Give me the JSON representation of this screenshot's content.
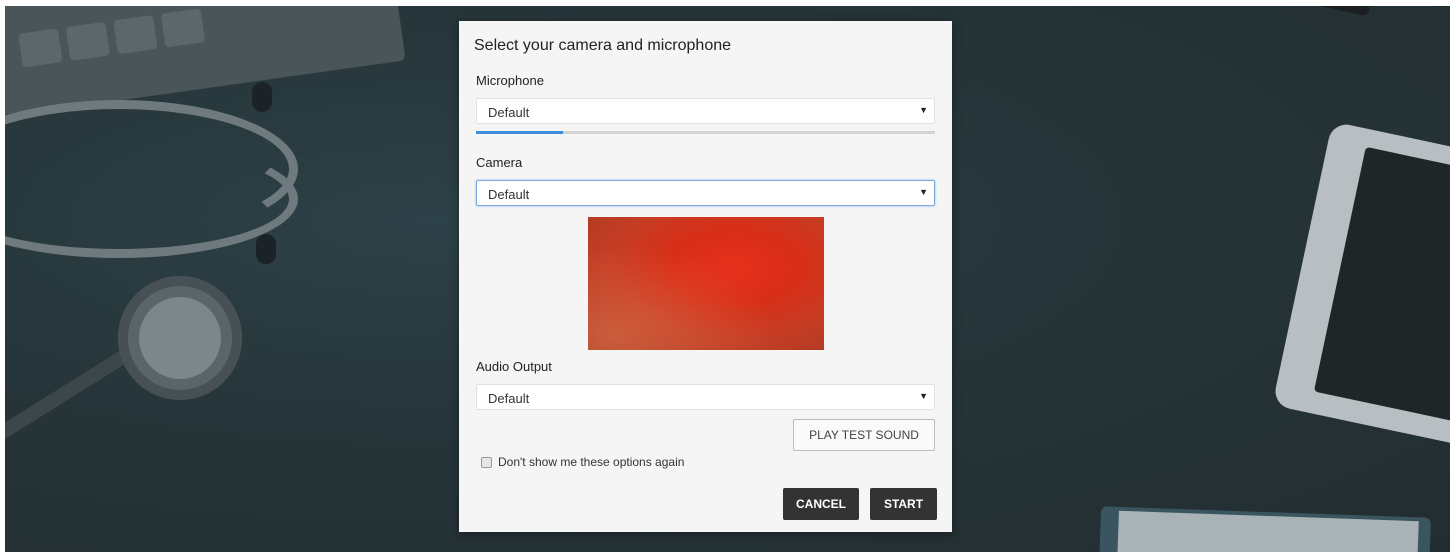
{
  "dialog": {
    "title": "Select your camera and microphone",
    "microphone": {
      "label": "Microphone",
      "selected": "Default",
      "level": 0.19
    },
    "camera": {
      "label": "Camera",
      "selected": "Default"
    },
    "audio_output": {
      "label": "Audio Output",
      "selected": "Default"
    },
    "play_test_sound_label": "PLAY TEST SOUND",
    "dont_show_label": "Don't show me these options again",
    "dont_show_checked": false,
    "cancel_label": "CANCEL",
    "start_label": "START"
  },
  "colors": {
    "accent": "#3d8fde",
    "button_dark": "#333333",
    "dialog_bg": "#f5f5f5"
  },
  "icons": {
    "select_caret": "caret-down-icon"
  }
}
